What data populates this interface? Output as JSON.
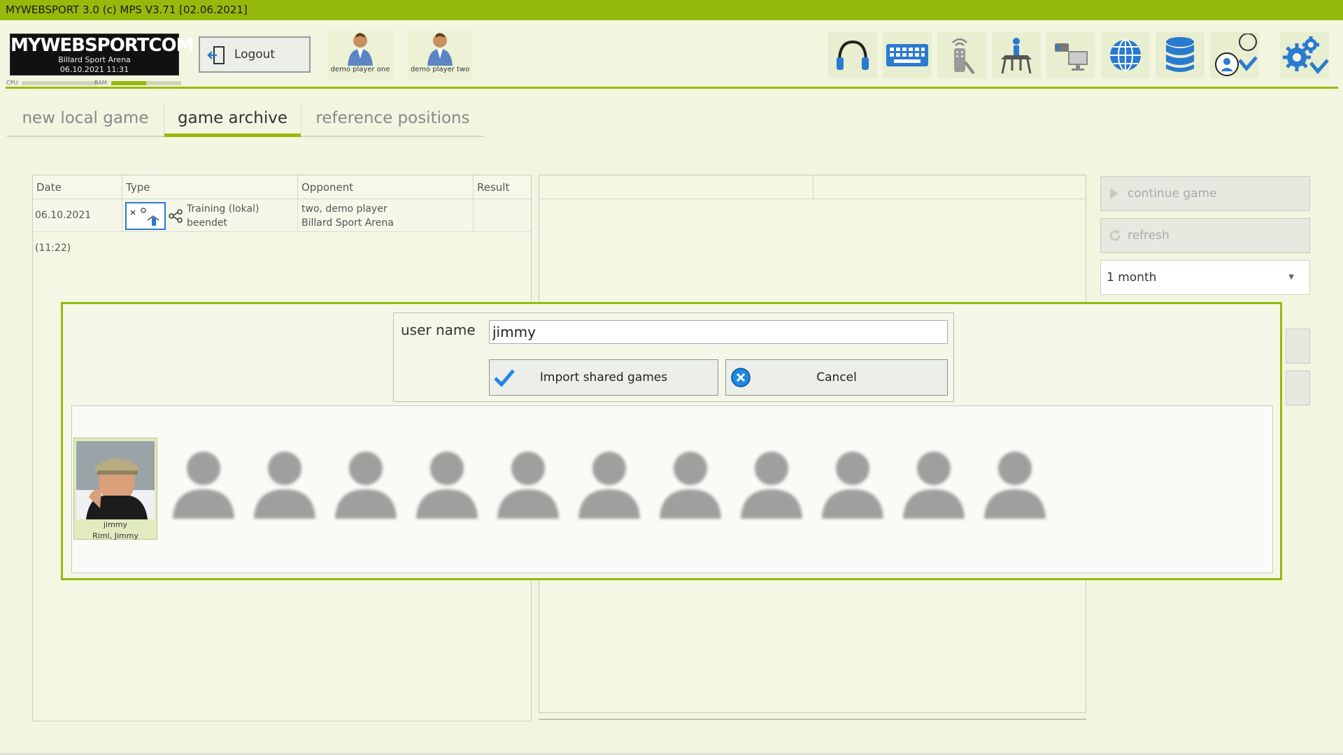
{
  "window": {
    "title": "MYWEBSPORT 3.0  (c) MPS V3.71 [02.06.2021]"
  },
  "logo": {
    "brand": "MYWEBSPORTCOM",
    "venue": "Billard Sport Arena",
    "datetime": "06.10.2021  11:31"
  },
  "meters": {
    "cpu_label": "CPU:",
    "ram_label": "RAM:",
    "cpu": 0.55,
    "ram": 0.5
  },
  "header": {
    "logout_label": "Logout",
    "players": [
      "demo player one",
      "demo player two"
    ],
    "toolbar_icons": [
      "headphones-icon",
      "keyboard-icon",
      "remote-control-icon",
      "podium-icon",
      "camera-monitor-icon",
      "globe-icon",
      "database-icon",
      "user-check-icon",
      "settings-check-icon"
    ]
  },
  "tabs": [
    {
      "label": "new local game",
      "active": false
    },
    {
      "label": "game archive",
      "active": true
    },
    {
      "label": "reference positions",
      "active": false
    }
  ],
  "archive_table": {
    "columns": [
      "Date",
      "Type",
      "Opponent",
      "Result"
    ],
    "rows": [
      {
        "date": "06.10.2021 (11:22)",
        "type_line1": "Training (lokal)",
        "type_line2": "beendet",
        "opponent_line1": "two, demo player",
        "opponent_line2": "Billard Sport Arena",
        "result": ""
      }
    ]
  },
  "side_panel": {
    "continue_label": "continue game",
    "refresh_label": "refresh",
    "period_value": "1 month"
  },
  "import_dialog": {
    "user_name_label": "user name",
    "user_name_value": "jimmy",
    "import_label": "Import shared games",
    "cancel_label": "Cancel",
    "users": [
      {
        "login": "jimmy",
        "name": "Riml, Jimmy",
        "selected": true
      }
    ],
    "blurred_user_count": 11,
    "colors": {
      "accent": "#95ba0b",
      "check": "#1e88e5"
    }
  }
}
